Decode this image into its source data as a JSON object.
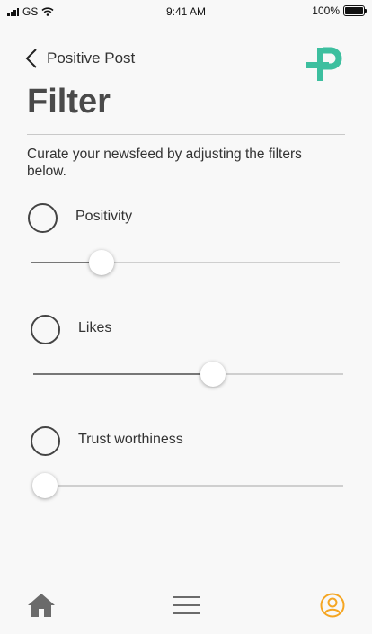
{
  "status_bar": {
    "carrier": "GS",
    "time": "9:41 AM",
    "battery": "100%"
  },
  "header": {
    "back_label": "Positive Post",
    "logo": "positive-post-logo"
  },
  "page": {
    "title": "Filter",
    "description": "Curate your newsfeed by adjusting the filters below."
  },
  "filters": [
    {
      "label": "Positivity",
      "selected": false,
      "value": 0.23
    },
    {
      "label": "Likes",
      "selected": false,
      "value": 0.58
    },
    {
      "label": "Trust worthiness",
      "selected": false,
      "value": 0.02
    }
  ],
  "tab_bar": {
    "items": [
      "home-icon",
      "menu-icon",
      "profile-icon"
    ],
    "active_color": "#f5a623"
  },
  "colors": {
    "brand": "#3dbf9f",
    "text": "#4a4a4a"
  }
}
